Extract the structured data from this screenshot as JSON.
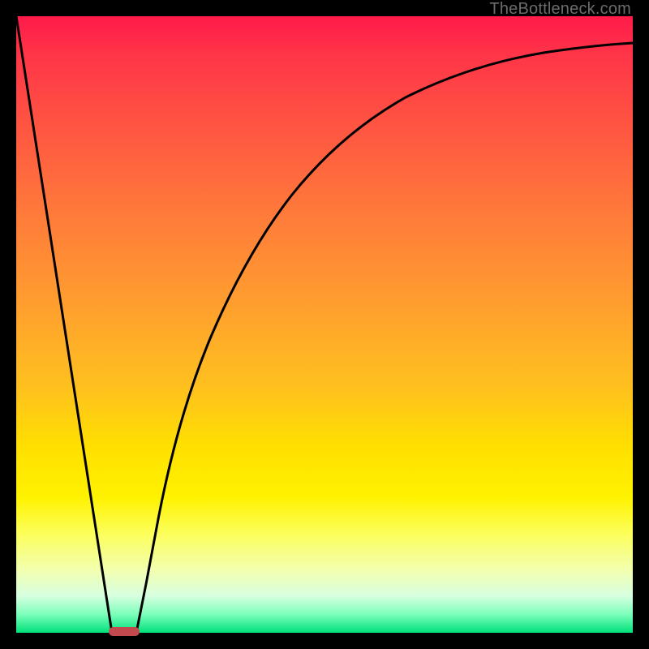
{
  "watermark": "TheBottleneck.com",
  "chart_data": {
    "type": "line",
    "title": "",
    "xlabel": "",
    "ylabel": "",
    "xlim": [
      0,
      100
    ],
    "ylim": [
      0,
      100
    ],
    "background_gradient": {
      "direction": "vertical",
      "stops": [
        {
          "pos": 0,
          "color": "#ff1a4a"
        },
        {
          "pos": 50,
          "color": "#ffb020"
        },
        {
          "pos": 80,
          "color": "#fff200"
        },
        {
          "pos": 100,
          "color": "#00e07a"
        }
      ]
    },
    "series": [
      {
        "name": "left-linear-drop",
        "type": "line",
        "x": [
          0,
          15.5
        ],
        "y": [
          100,
          0
        ]
      },
      {
        "name": "right-rise-curve",
        "type": "line",
        "x": [
          19.5,
          22,
          25,
          28,
          32,
          36,
          40,
          45,
          50,
          56,
          63,
          72,
          82,
          92,
          100
        ],
        "y": [
          0,
          12,
          24,
          35,
          46,
          55,
          62,
          69,
          75,
          80,
          84,
          88,
          91,
          93,
          94.5
        ]
      }
    ],
    "marker": {
      "shape": "rounded-rect",
      "color": "#c24a4e",
      "x_range": [
        15.5,
        19.5
      ],
      "y": 0
    },
    "frame_color": "#000000"
  }
}
